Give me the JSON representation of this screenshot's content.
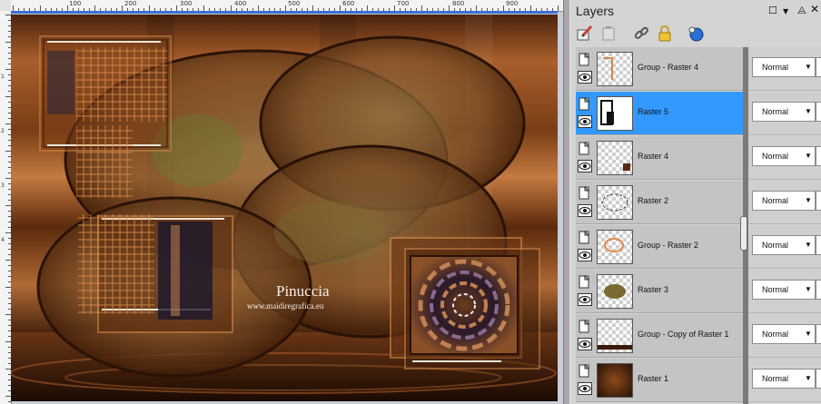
{
  "canvas": {
    "ruler_top_labels": [
      "100",
      "200",
      "300",
      "400",
      "500",
      "600",
      "700",
      "800",
      "900"
    ],
    "ruler_left_labels": [
      "1",
      "2",
      "3",
      "4"
    ],
    "watermark": {
      "name": "Pinuccia",
      "site": "www.maidiregrafica.eu"
    }
  },
  "layers_panel": {
    "title": "Layers",
    "header_icons": [
      "maximize-icon",
      "dropdown-icon",
      "pin-icon",
      "close-icon"
    ],
    "toolbar_icons": [
      "properties-brush-icon",
      "delete-layer-icon",
      "link-icon",
      "lock-icon",
      "mask-icon"
    ],
    "layers": [
      {
        "name": "Group - Raster 4",
        "blend": "Normal",
        "selected": false
      },
      {
        "name": "Raster 5",
        "blend": "Normal",
        "selected": true
      },
      {
        "name": "Raster 4",
        "blend": "Normal",
        "selected": false
      },
      {
        "name": "Raster 2",
        "blend": "Normal",
        "selected": false
      },
      {
        "name": "Group - Raster 2",
        "blend": "Normal",
        "selected": false
      },
      {
        "name": "Raster 3",
        "blend": "Normal",
        "selected": false
      },
      {
        "name": "Group - Copy of Raster 1",
        "blend": "Normal",
        "selected": false
      },
      {
        "name": "Raster 1",
        "blend": "Normal",
        "selected": false
      }
    ]
  },
  "colors": {
    "selection": "#3399ff",
    "artwork_copper": "#b56a35",
    "artwork_dark": "#2a1206"
  }
}
